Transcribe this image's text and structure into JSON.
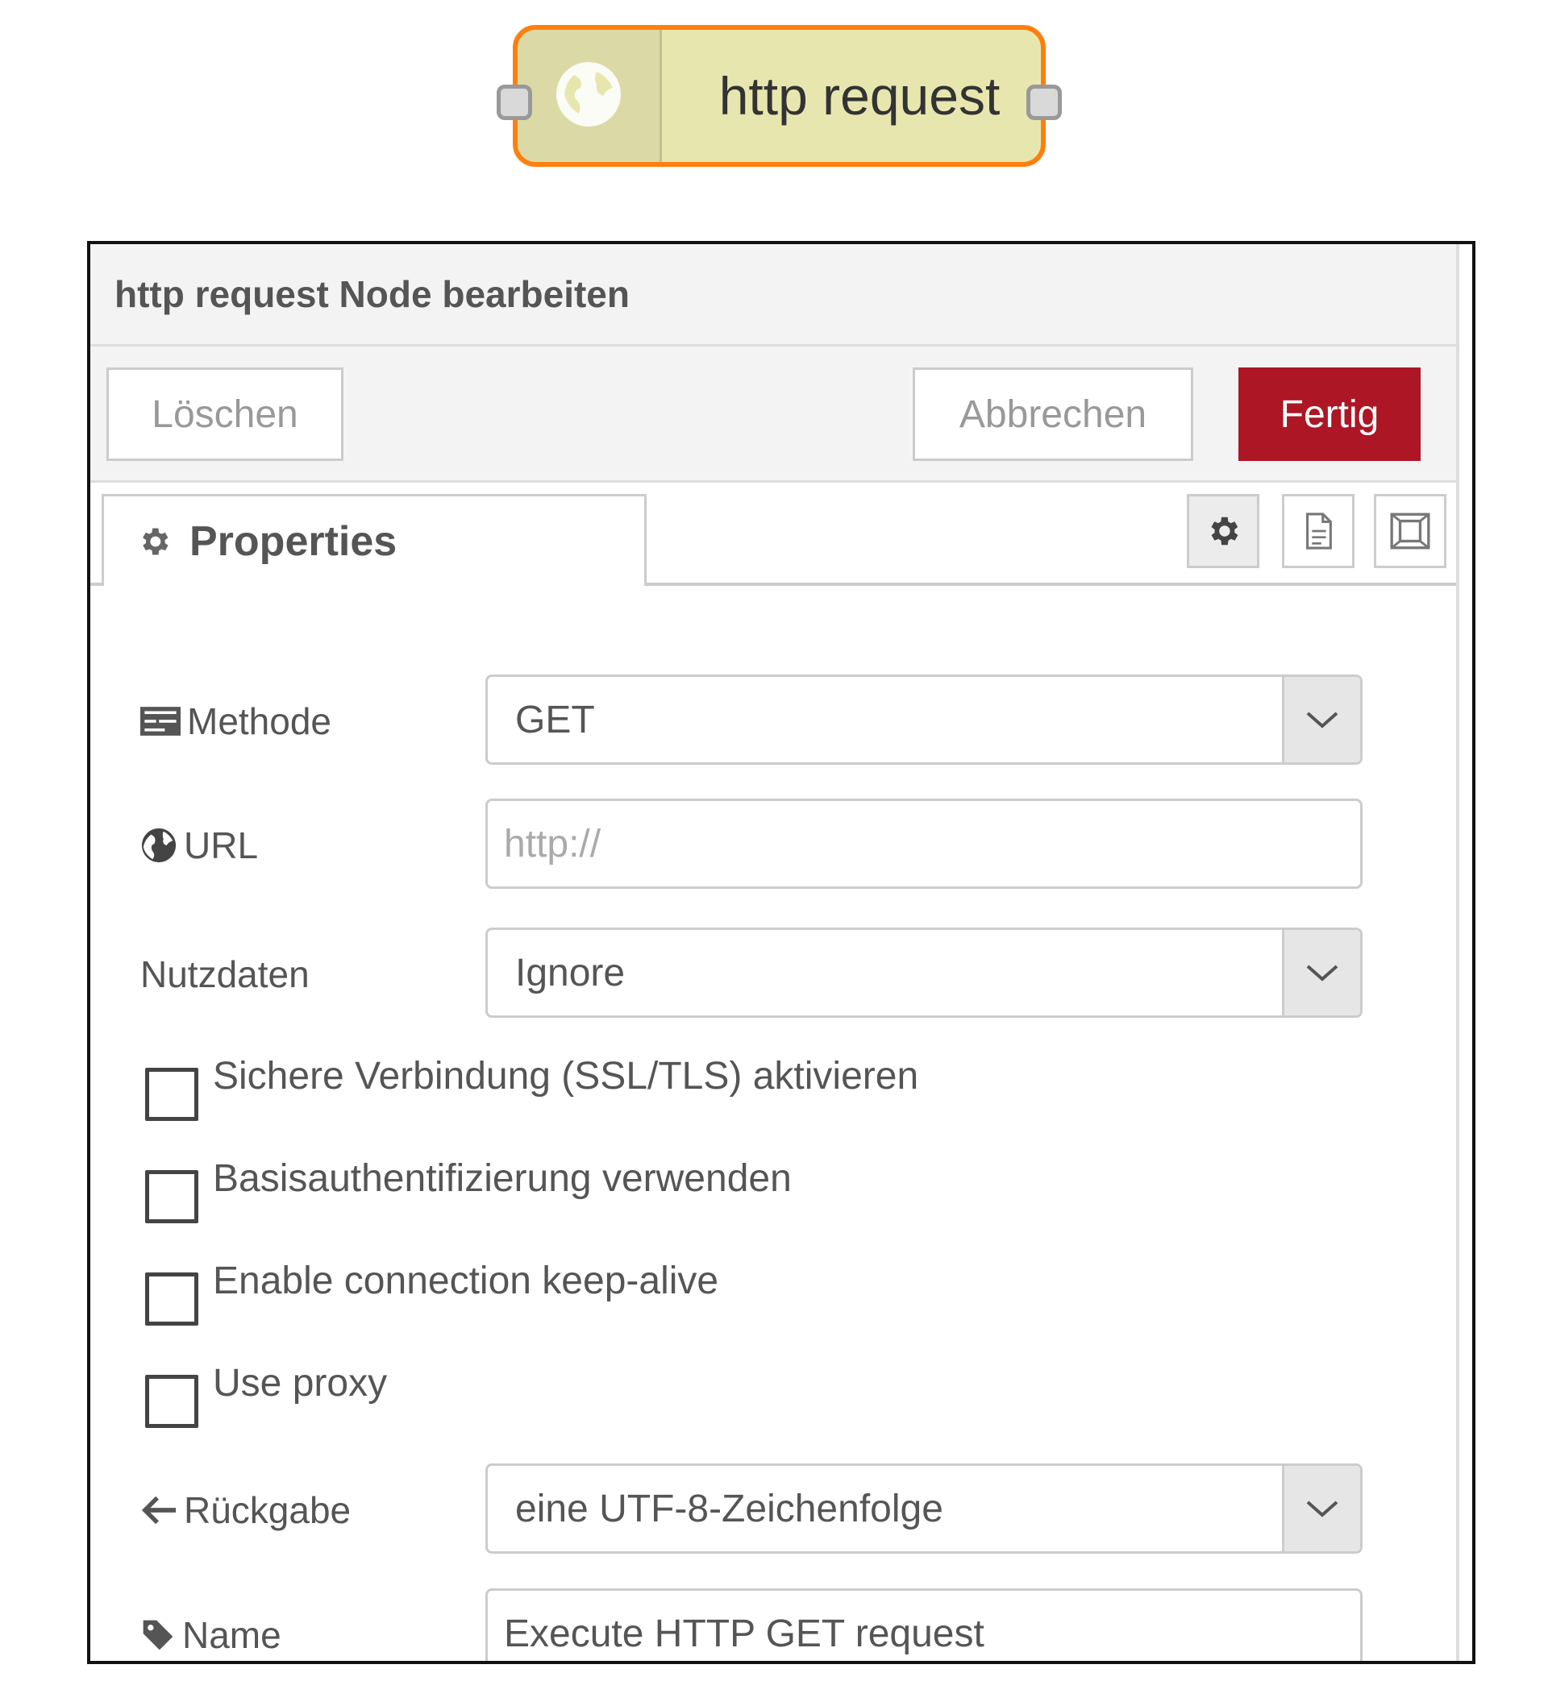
{
  "node": {
    "label": "http request",
    "icon": "globe-icon"
  },
  "dialog": {
    "title": "http request Node bearbeiten",
    "buttons": {
      "delete": "Löschen",
      "cancel": "Abbrechen",
      "done": "Fertig"
    },
    "tabs": {
      "properties_label": "Properties",
      "icons": [
        "gear-icon",
        "description-icon",
        "appearance-icon"
      ]
    },
    "form": {
      "method": {
        "label": "Methode",
        "value": "GET"
      },
      "url": {
        "label": "URL",
        "placeholder": "http://"
      },
      "payload": {
        "label": "Nutzdaten",
        "value": "Ignore"
      },
      "checkboxes": [
        {
          "label": "Sichere Verbindung (SSL/TLS) aktivieren",
          "checked": false
        },
        {
          "label": "Basisauthentifizierung verwenden",
          "checked": false
        },
        {
          "label": "Enable connection keep-alive",
          "checked": false
        },
        {
          "label": "Use proxy",
          "checked": false
        }
      ],
      "return": {
        "label": "Rückgabe",
        "value": "eine UTF-8-Zeichenfolge"
      },
      "name": {
        "label": "Name",
        "value": "Execute HTTP GET request"
      }
    }
  },
  "colors": {
    "node_fill": "#e7e6af",
    "node_border": "#ff7f0e",
    "done_button": "#ad1625"
  }
}
